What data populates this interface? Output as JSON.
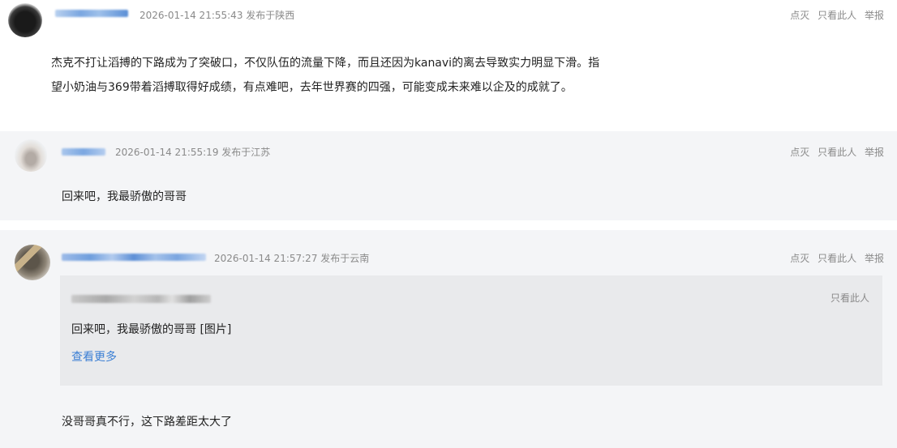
{
  "comments": [
    {
      "timestamp": "2026-01-14 21:55:43",
      "location": "发布于陕西",
      "actions": [
        "点灭",
        "只看此人",
        "举报"
      ],
      "text_lines": [
        "杰克不打让滔搏的下路成为了突破口，不仅队伍的流量下降，而且还因为kanavi的离去导致实力明显下滑。指",
        "望小奶油与369带着滔搏取得好成绩，有点难吧，去年世界赛的四强，可能变成未来难以企及的成就了。"
      ]
    },
    {
      "timestamp": "2026-01-14 21:55:19",
      "location": "发布于江苏",
      "actions": [
        "点灭",
        "只看此人",
        "举报"
      ],
      "text": "回来吧，我最骄傲的哥哥"
    },
    {
      "timestamp": "2026-01-14 21:57:27",
      "location": "发布于云南",
      "actions": [
        "点灭",
        "只看此人",
        "举报"
      ],
      "quote": {
        "only_label": "只看此人",
        "text": "回来吧，我最骄傲的哥哥 [图片]",
        "more_label": "查看更多"
      },
      "text": "没哥哥真不行，这下路差距太大了"
    }
  ],
  "colors": {
    "meta_gray": "#8a8a8a",
    "link_blue": "#3b7fd4",
    "card_bg": "#f4f5f7",
    "quote_bg": "#e9eaec"
  }
}
